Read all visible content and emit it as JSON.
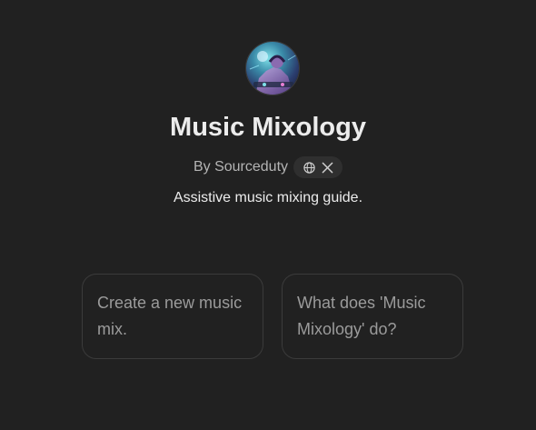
{
  "gpt": {
    "name": "Music Mixology",
    "byline": "By Sourceduty",
    "description": "Assistive music mixing guide.",
    "link_icons": [
      "globe-icon",
      "x-logo-icon"
    ]
  },
  "starters": [
    {
      "text": "Create a new music mix."
    },
    {
      "text": "What does 'Music Mixology' do?"
    }
  ],
  "colors": {
    "background": "#212121",
    "title": "#ececec",
    "muted": "#b4b4b4",
    "card_border": "#3b3b3b",
    "card_text": "#9b9b9b"
  }
}
